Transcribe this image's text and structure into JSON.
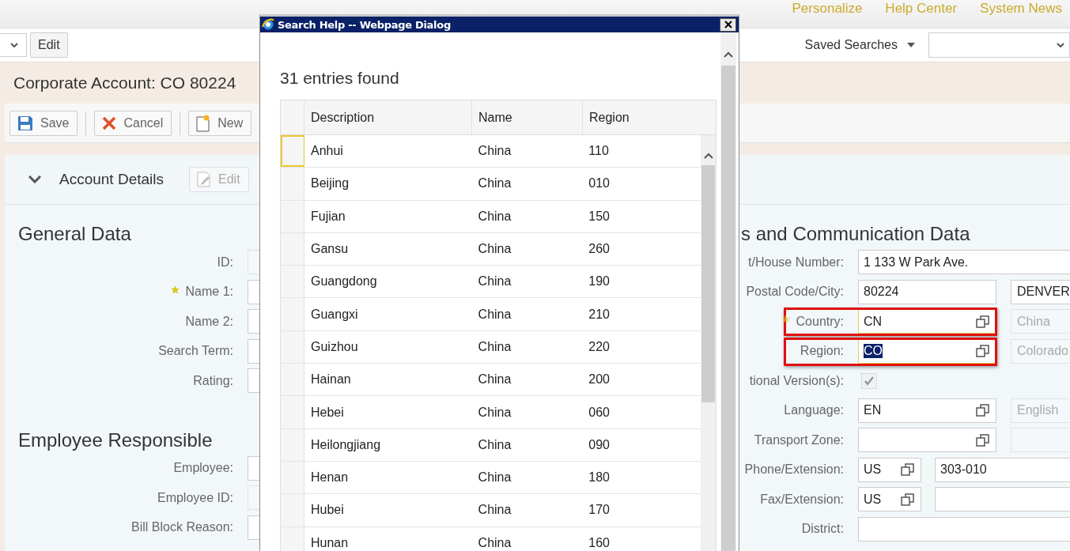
{
  "top_links": [
    "Personalize",
    "Help Center",
    "System News"
  ],
  "toolbar": {
    "edit_button": "Edit",
    "saved_searches": "Saved Searches"
  },
  "page_title": "Corporate Account: CO 80224",
  "actions": [
    {
      "label": "Save",
      "kind": "save"
    },
    {
      "label": "Cancel",
      "kind": "cancel"
    },
    {
      "label": "New",
      "kind": "new"
    }
  ],
  "section": {
    "title": "Account Details",
    "expanded": true,
    "edit_button": {
      "label": "Edit",
      "disabled": true
    }
  },
  "general_data": {
    "title": "General Data",
    "fields": [
      {
        "label": "ID:",
        "required": false,
        "readonly": true
      },
      {
        "label": "Name 1:",
        "required": true,
        "readonly": false
      },
      {
        "label": "Name 2:",
        "required": false,
        "readonly": false
      },
      {
        "label": "Search Term:",
        "required": false,
        "readonly": false
      },
      {
        "label": "Rating:",
        "required": false,
        "readonly": false
      }
    ]
  },
  "employee_responsible": {
    "title": "Employee Responsible",
    "fields": [
      {
        "label": "Employee:",
        "required": false,
        "readonly": false
      },
      {
        "label": "Employee ID:",
        "required": false,
        "readonly": true
      },
      {
        "label": "Bill Block Reason:",
        "required": false,
        "readonly": false
      }
    ]
  },
  "address_data": {
    "title": "s and Communication Data",
    "fields": [
      {
        "kind": "wide",
        "label": "t/House Number:",
        "value": "1 133 W Park Ave."
      },
      {
        "kind": "pair",
        "label": "Postal Code/City:",
        "value": "80224",
        "value_2": "DENVER"
      },
      {
        "kind": "lookup",
        "label": "Country:",
        "value": "CN",
        "description": "China",
        "required": true,
        "highlighted": true,
        "value_selected": false
      },
      {
        "kind": "lookup",
        "label": "Region:",
        "value": "CO",
        "description": "Colorado",
        "required": false,
        "highlighted": true,
        "value_selected": true
      },
      {
        "kind": "checkbox",
        "label": "tional Version(s):",
        "checked": true,
        "disabled": true
      },
      {
        "kind": "lookup",
        "label": "Language:",
        "value": "EN",
        "description": "English",
        "required": false,
        "highlighted": false,
        "value_selected": false
      },
      {
        "kind": "lookup",
        "label": "Transport Zone:",
        "required": false,
        "highlighted": false
      },
      {
        "kind": "phone",
        "label": "Phone/Extension:",
        "value": "US",
        "value_2": "303-010"
      },
      {
        "kind": "phone",
        "label": "Fax/Extension:",
        "value": "US"
      },
      {
        "kind": "wide",
        "label": "District:"
      }
    ]
  },
  "dialog": {
    "title": "Search Help -- Webpage Dialog",
    "count": "31 entries found",
    "columns": [
      "Description",
      "Name",
      "Region"
    ],
    "rows": [
      {
        "cells": [
          "Anhui",
          "China",
          "110"
        ],
        "selected": true
      },
      {
        "cells": [
          "Beijing",
          "China",
          "010"
        ],
        "selected": false
      },
      {
        "cells": [
          "Fujian",
          "China",
          "150"
        ],
        "selected": false
      },
      {
        "cells": [
          "Gansu",
          "China",
          "260"
        ],
        "selected": false
      },
      {
        "cells": [
          "Guangdong",
          "China",
          "190"
        ],
        "selected": false
      },
      {
        "cells": [
          "Guangxi",
          "China",
          "210"
        ],
        "selected": false
      },
      {
        "cells": [
          "Guizhou",
          "China",
          "220"
        ],
        "selected": false
      },
      {
        "cells": [
          "Hainan",
          "China",
          "200"
        ],
        "selected": false
      },
      {
        "cells": [
          "Hebei",
          "China",
          "060"
        ],
        "selected": false
      },
      {
        "cells": [
          "Heilongjiang",
          "China",
          "090"
        ],
        "selected": false
      },
      {
        "cells": [
          "Henan",
          "China",
          "180"
        ],
        "selected": false
      },
      {
        "cells": [
          "Hubei",
          "China",
          "170"
        ],
        "selected": false
      },
      {
        "cells": [
          "Hunan",
          "China",
          "160"
        ],
        "selected": false
      }
    ]
  }
}
